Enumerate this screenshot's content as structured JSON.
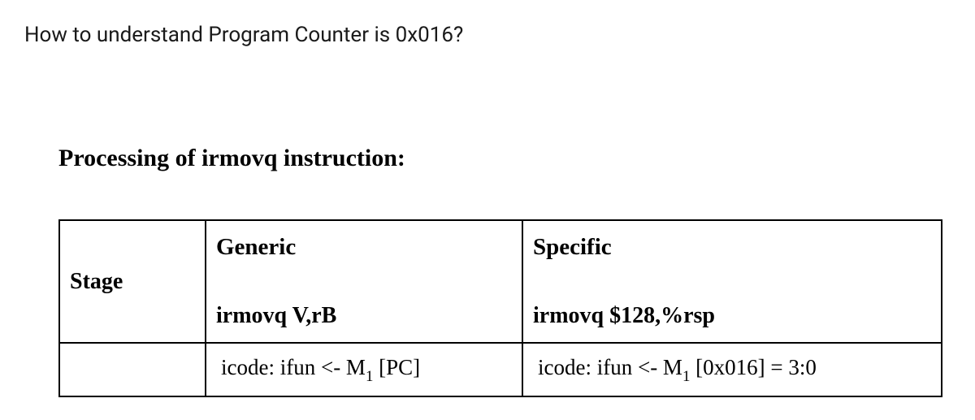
{
  "question": "How to understand Program Counter is  0x016?",
  "heading": "Processing of irmovq instruction:",
  "table": {
    "stage_label": "Stage",
    "header": {
      "generic_top": "Generic",
      "generic_bottom": "irmovq V,rB",
      "specific_top": "Specific",
      "specific_bottom": "irmovq $128,%rsp"
    },
    "row1": {
      "generic_prefix": "icode: ifun <- M",
      "generic_sub": "1",
      "generic_suffix": " [PC]",
      "specific_prefix": "icode: ifun <- M",
      "specific_sub": "1",
      "specific_suffix": " [0x016]  = 3:0"
    }
  }
}
